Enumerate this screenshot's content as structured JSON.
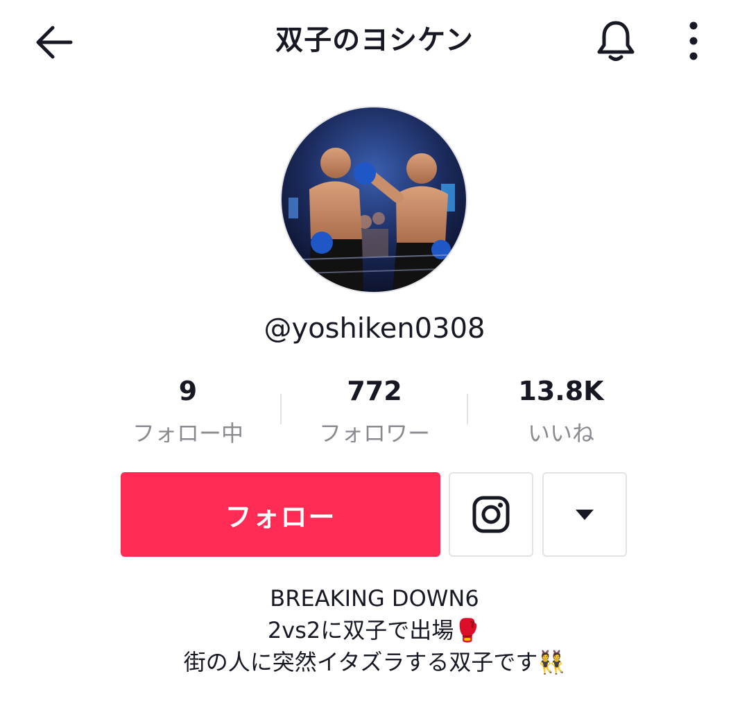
{
  "header": {
    "back_icon": "arrow-left-icon",
    "title": "双子のヨシケン",
    "bell_icon": "bell-icon",
    "more_icon": "more-vertical-icon"
  },
  "profile": {
    "username": "@yoshiken0308",
    "avatar_description_icon": "avatar-photo"
  },
  "stats": [
    {
      "value": "9",
      "label": "フォロー中"
    },
    {
      "value": "772",
      "label": "フォロワー"
    },
    {
      "value": "13.8K",
      "label": "いいね"
    }
  ],
  "actions": {
    "follow_label": "フォロー",
    "instagram_icon": "instagram-icon",
    "dropdown_icon": "caret-down-icon"
  },
  "bio": {
    "lines": [
      "BREAKING DOWN6",
      "2vs2に双子で出場🥊",
      "街の人に突然イタズラする双子です👯"
    ]
  },
  "colors": {
    "accent": "#fe2c55",
    "text_primary": "#161823",
    "text_secondary": "#8a8b91",
    "border": "#e3e3e6"
  }
}
